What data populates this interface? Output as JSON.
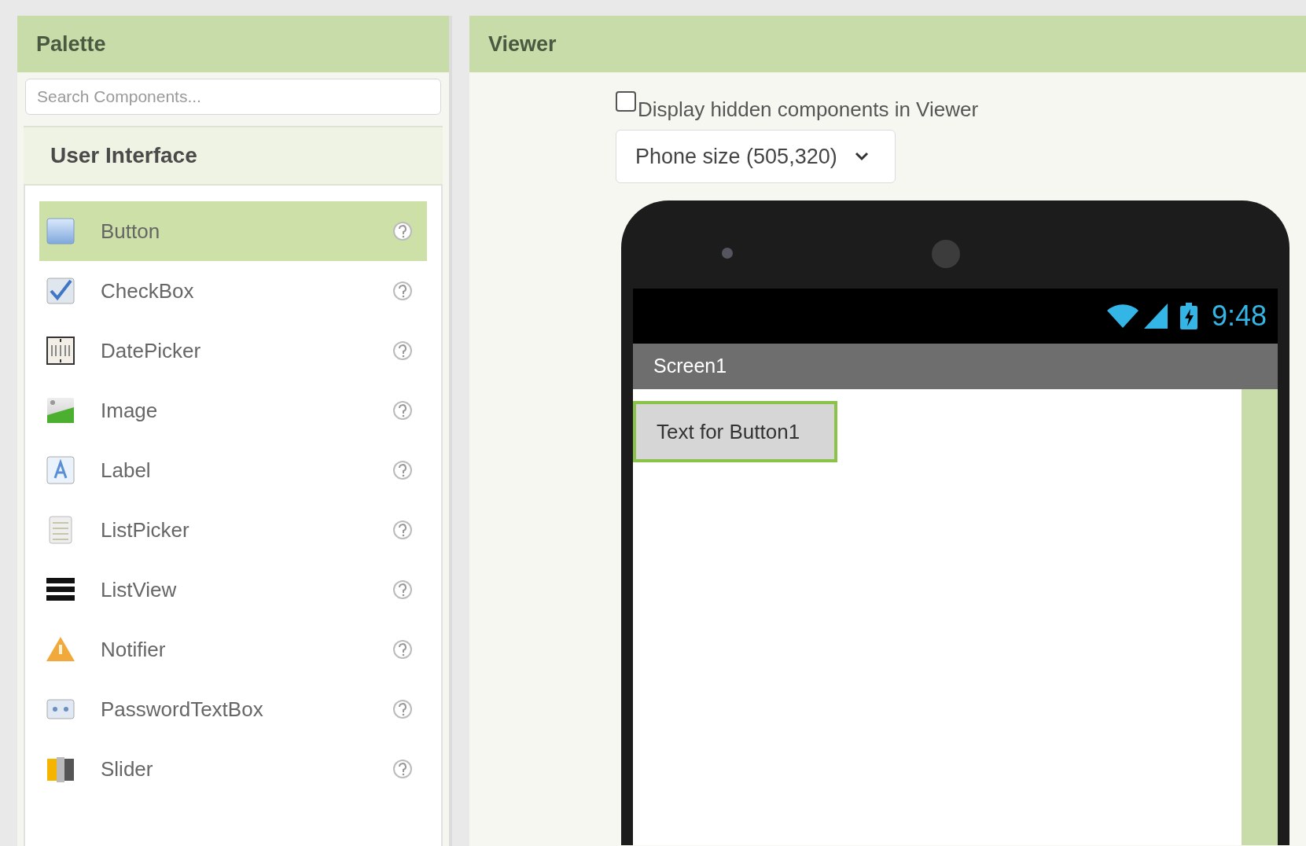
{
  "palette": {
    "title": "Palette",
    "search": {
      "placeholder": "Search Components..."
    },
    "category": "User Interface",
    "items": [
      {
        "label": "Button",
        "kind": "button",
        "selected": true
      },
      {
        "label": "CheckBox",
        "kind": "checkbox",
        "selected": false
      },
      {
        "label": "DatePicker",
        "kind": "datepicker",
        "selected": false
      },
      {
        "label": "Image",
        "kind": "image",
        "selected": false
      },
      {
        "label": "Label",
        "kind": "label",
        "selected": false
      },
      {
        "label": "ListPicker",
        "kind": "listpicker",
        "selected": false
      },
      {
        "label": "ListView",
        "kind": "listview",
        "selected": false
      },
      {
        "label": "Notifier",
        "kind": "notifier",
        "selected": false
      },
      {
        "label": "PasswordTextBox",
        "kind": "password",
        "selected": false
      },
      {
        "label": "Slider",
        "kind": "slider",
        "selected": false
      }
    ]
  },
  "viewer": {
    "title": "Viewer",
    "hidden_toggle": {
      "label": "Display hidden components in Viewer",
      "checked": false
    },
    "size_select": {
      "value": "Phone size (505,320)"
    },
    "phone": {
      "time": "9:48",
      "screen_title": "Screen1",
      "button": {
        "text": "Text for Button1",
        "selected": true
      }
    }
  }
}
